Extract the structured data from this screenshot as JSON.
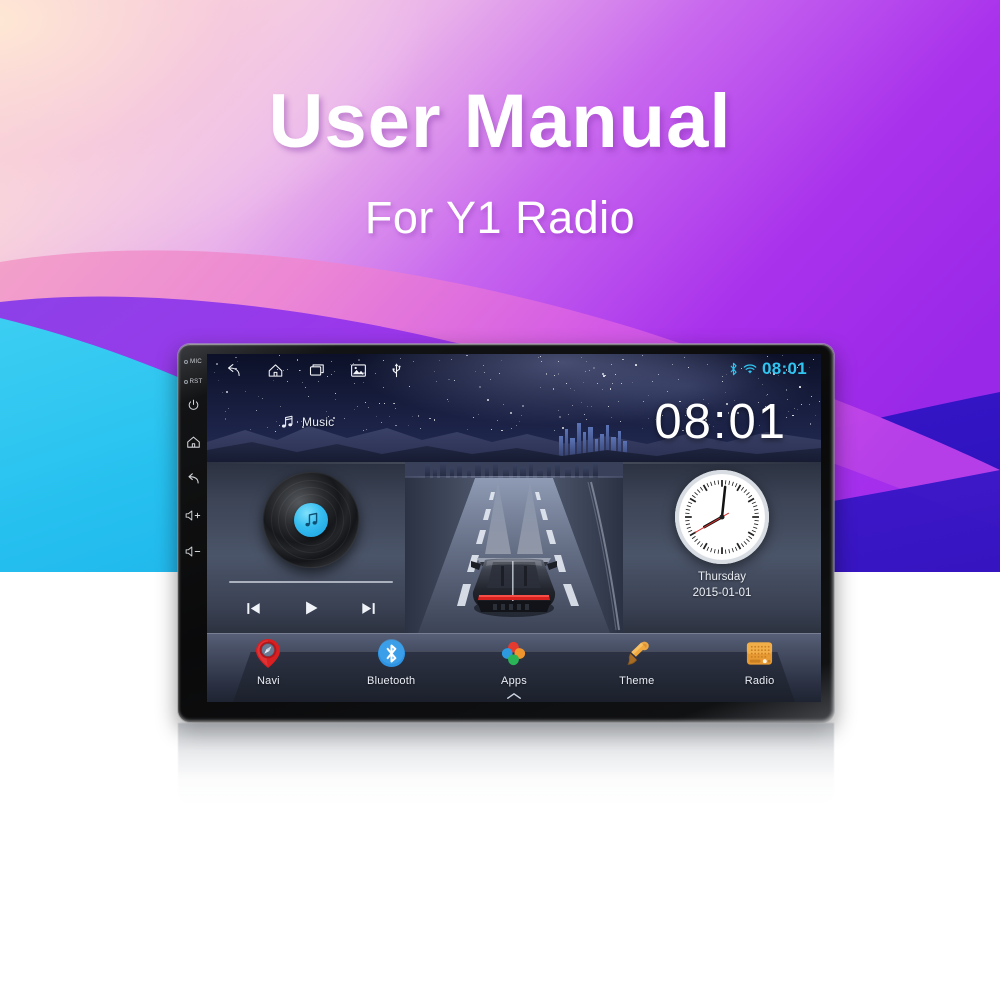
{
  "page": {
    "title_main": "User Manual",
    "title_sub": "For Y1 Radio",
    "background_colors": {
      "cream": "#fbe0c8",
      "pink": "#f0a7d4",
      "magenta": "#d96fd0",
      "purple": "#a733e8",
      "violet": "#8c2fe0",
      "indigo": "#3a18c8",
      "cyan": "#2ec6f0",
      "white": "#ffffff"
    }
  },
  "device": {
    "hardware_buttons": [
      {
        "name": "MIC",
        "type": "label-dot"
      },
      {
        "name": "RST",
        "type": "label-dot"
      },
      {
        "name": "power-icon",
        "type": "icon"
      },
      {
        "name": "home-icon",
        "type": "icon"
      },
      {
        "name": "back-icon",
        "type": "icon"
      },
      {
        "name": "volume-up-icon",
        "type": "icon",
        "glyph": "+"
      },
      {
        "name": "volume-down-icon",
        "type": "icon",
        "glyph": "−"
      }
    ],
    "hw_labels": {
      "mic": "MIC",
      "rst": "RST"
    }
  },
  "statusbar": {
    "nav_icons": [
      "back-icon",
      "home-icon",
      "recents-icon",
      "gallery-icon",
      "usb-icon"
    ],
    "bluetooth_icon": "bluetooth-icon",
    "wifi_icon": "wifi-icon",
    "clock": "08:01",
    "accent_color": "#2fc5f0"
  },
  "screen": {
    "music_shortcut_label": "Music",
    "big_clock": "08:01"
  },
  "music_widget": {
    "prev_label": "prev-track",
    "play_label": "play",
    "next_label": "next-track",
    "progress_percent": 0
  },
  "clock_widget": {
    "day": "Thursday",
    "date": "2015-01-01",
    "hour": 8,
    "minute": 1,
    "second": 40
  },
  "dock": {
    "items": [
      {
        "label": "Navi",
        "icon": "map-pin-icon",
        "color": "#e02727"
      },
      {
        "label": "Bluetooth",
        "icon": "bluetooth-icon",
        "color": "#2b8fe0"
      },
      {
        "label": "Apps",
        "icon": "apps-flower-icon",
        "color": "#e03b32"
      },
      {
        "label": "Theme",
        "icon": "paint-brush-icon",
        "color": "#e59b33"
      },
      {
        "label": "Radio",
        "icon": "radio-icon",
        "color": "#eda23c"
      }
    ],
    "expand_chevron": "chevron-up-icon"
  }
}
